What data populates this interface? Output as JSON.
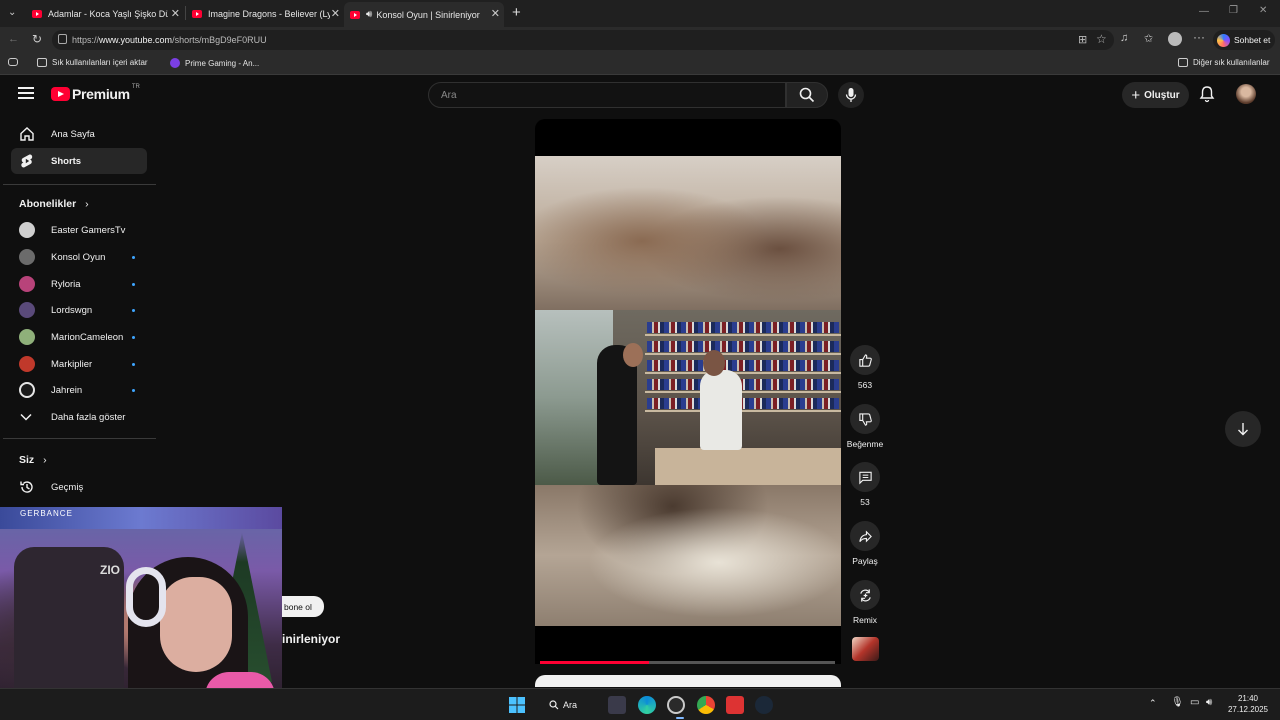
{
  "browser": {
    "tabs": [
      {
        "title": "Adamlar - Koca Yaşlı Şişko Dünya"
      },
      {
        "title": "Imagine Dragons - Believer (Lyrics)"
      },
      {
        "title": "Konsol Oyun | Sinirleniyor - Yo"
      }
    ],
    "url_prefix": "https://",
    "url_domain": "www.youtube.com",
    "url_path": "/shorts/mBgD9eF0RUU",
    "copilot_label": "Sohbet et",
    "bookmarks": [
      {
        "label": "Sık kullanılanları içeri aktar"
      },
      {
        "label": "Prime Gaming - An..."
      }
    ],
    "other_favorites": "Diğer sık kullanılanlar"
  },
  "masthead": {
    "logo_text": "Premium",
    "logo_region": "TR",
    "search_placeholder": "Ara",
    "create_label": "Oluştur"
  },
  "sidebar": {
    "main": [
      {
        "label": "Ana Sayfa",
        "icon": "home-icon"
      },
      {
        "label": "Shorts",
        "icon": "shorts-icon",
        "active": true
      }
    ],
    "subscriptions_title": "Abonelikler",
    "subscriptions": [
      {
        "name": "Easter GamersTv",
        "color": "#cfcfcf",
        "new": false
      },
      {
        "name": "Konsol Oyun",
        "color": "#6b6b6b",
        "new": true
      },
      {
        "name": "Ryloria",
        "color": "#b8437a",
        "new": true
      },
      {
        "name": "Lordswgn",
        "color": "#5a4a7a",
        "new": true
      },
      {
        "name": "MarionCameleon",
        "color": "#8fb07a",
        "new": true
      },
      {
        "name": "Markiplier",
        "color": "#c0392b",
        "new": true
      },
      {
        "name": "Jahrein",
        "color": "#e5e5e5",
        "new": true
      }
    ],
    "show_more": "Daha fazla göster",
    "you_title": "Siz",
    "history": "Geçmiş"
  },
  "short": {
    "likes": "563",
    "dislike_label": "Beğenme",
    "comments": "53",
    "share_label": "Paylaş",
    "remix_label": "Remix",
    "progress": 0.37,
    "subscribe_fragment": "bone ol",
    "title_fragment": "inirleniyor"
  },
  "webcam": {
    "chair_text": "ZIO",
    "top_text": "GERBANCE"
  },
  "taskbar": {
    "search_label": "Ara",
    "time": "21:40",
    "date": "27.12.2025"
  },
  "colors": {
    "accent": "#ff0033",
    "background": "#0f0f0f",
    "chip": "#272727"
  }
}
